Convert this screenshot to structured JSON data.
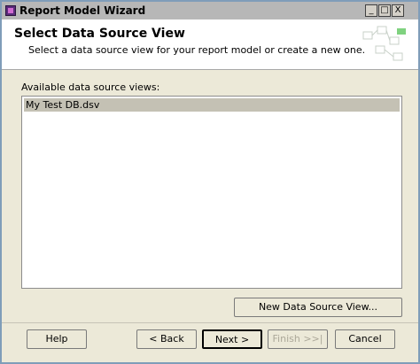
{
  "window": {
    "title": "Report Model Wizard",
    "controls": {
      "minimize": "_",
      "maximize": "□",
      "close": "X"
    }
  },
  "header": {
    "title": "Select Data Source View",
    "subtitle": "Select a data source view for your report model or create a new one."
  },
  "content": {
    "list_label": "Available data source views:",
    "items": [
      "My Test DB.dsv"
    ]
  },
  "buttons": {
    "new_dsv": "New Data Source View...",
    "help": "Help",
    "back": "< Back",
    "next": "Next >",
    "finish": "Finish >>|",
    "cancel": "Cancel"
  }
}
